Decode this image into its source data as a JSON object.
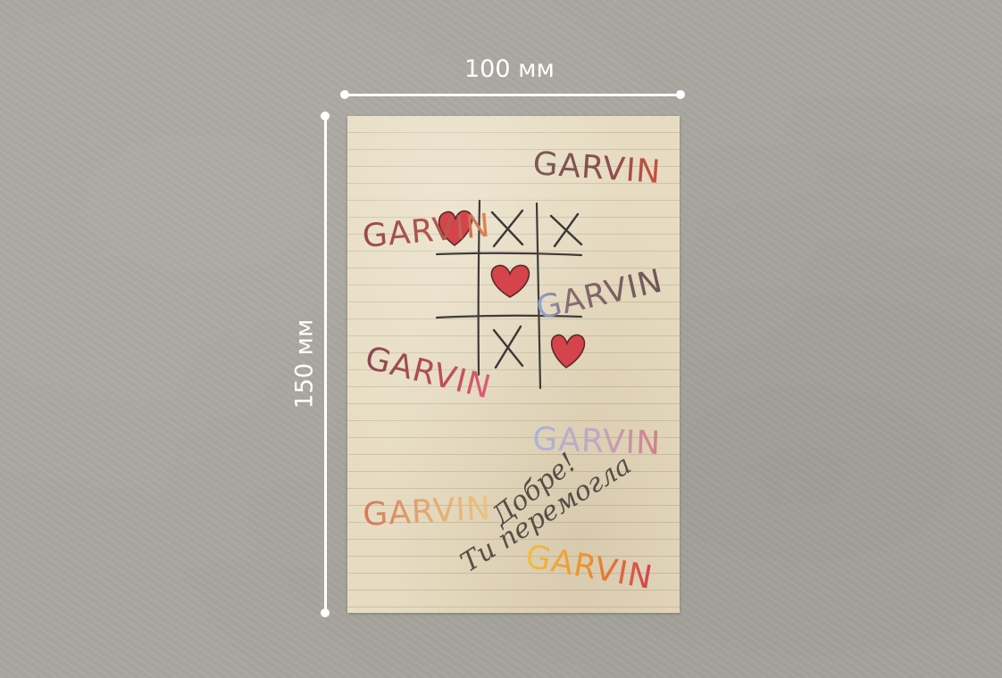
{
  "dimensions": {
    "width_label": "100 мм",
    "height_label": "150 мм"
  },
  "card": {
    "brand_words": [
      "GARVIN",
      "GARVIN",
      "GARVIN",
      "GARVIN",
      "GARVIN",
      "GARVIN",
      "GARVIN"
    ],
    "handwriting": {
      "line1": "Добре!",
      "line2": "Ти перемогла"
    },
    "tic_tac_toe": {
      "cells": [
        "heart",
        "X",
        "X",
        "",
        "heart",
        "",
        "",
        "X",
        "heart"
      ]
    },
    "colors": {
      "background": "#a8a69f",
      "paper": "#e7dcc2",
      "heart": "#d4444a",
      "ink": "#3d3a36",
      "dimension_lines": "#ffffff"
    }
  }
}
